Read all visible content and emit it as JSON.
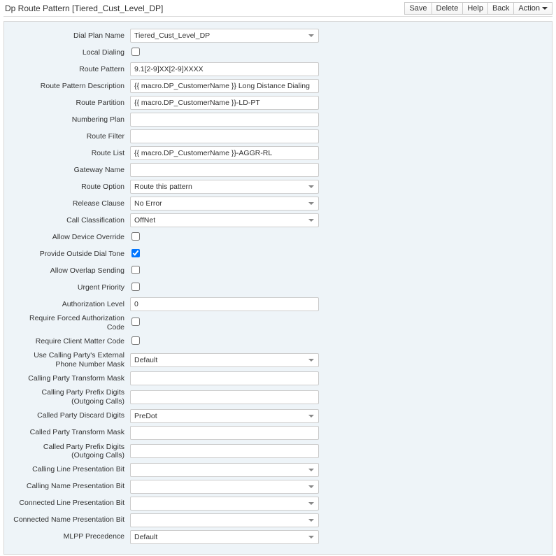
{
  "header": {
    "title": "Dp Route Pattern [Tiered_Cust_Level_DP]",
    "buttons": {
      "save": "Save",
      "delete": "Delete",
      "help": "Help",
      "back": "Back",
      "action": "Action"
    }
  },
  "fields": {
    "dial_plan_name": {
      "label": "Dial Plan Name",
      "value": "Tiered_Cust_Level_DP"
    },
    "local_dialing": {
      "label": "Local Dialing",
      "checked": false
    },
    "route_pattern": {
      "label": "Route Pattern",
      "value": "9.1[2-9]XX[2-9]XXXX"
    },
    "route_pattern_description": {
      "label": "Route Pattern Description",
      "value": "{{ macro.DP_CustomerName }} Long Distance Dialing"
    },
    "route_partition": {
      "label": "Route Partition",
      "value": "{{ macro.DP_CustomerName }}-LD-PT"
    },
    "numbering_plan": {
      "label": "Numbering Plan",
      "value": ""
    },
    "route_filter": {
      "label": "Route Filter",
      "value": ""
    },
    "route_list": {
      "label": "Route List",
      "value": "{{ macro.DP_CustomerName }}-AGGR-RL"
    },
    "gateway_name": {
      "label": "Gateway Name",
      "value": ""
    },
    "route_option": {
      "label": "Route Option",
      "value": "Route this pattern"
    },
    "release_clause": {
      "label": "Release Clause",
      "value": "No Error"
    },
    "call_classification": {
      "label": "Call Classification",
      "value": "OffNet"
    },
    "allow_device_override": {
      "label": "Allow Device Override",
      "checked": false
    },
    "provide_outside_dial_tone": {
      "label": "Provide Outside Dial Tone",
      "checked": true
    },
    "allow_overlap_sending": {
      "label": "Allow Overlap Sending",
      "checked": false
    },
    "urgent_priority": {
      "label": "Urgent Priority",
      "checked": false
    },
    "authorization_level": {
      "label": "Authorization Level",
      "value": "0"
    },
    "require_forced_authorization_code": {
      "label": "Require Forced Authorization Code",
      "checked": false
    },
    "require_client_matter_code": {
      "label": "Require Client Matter Code",
      "checked": false
    },
    "use_calling_party_external_mask": {
      "label": "Use Calling Party's External Phone Number Mask",
      "value": "Default"
    },
    "calling_party_transform_mask": {
      "label": "Calling Party Transform Mask",
      "value": ""
    },
    "calling_party_prefix_digits": {
      "label": "Calling Party Prefix Digits (Outgoing Calls)",
      "value": ""
    },
    "called_party_discard_digits": {
      "label": "Called Party Discard Digits",
      "value": "PreDot"
    },
    "called_party_transform_mask": {
      "label": "Called Party Transform Mask",
      "value": ""
    },
    "called_party_prefix_digits": {
      "label": "Called Party Prefix Digits (Outgoing Calls)",
      "value": ""
    },
    "calling_line_presentation_bit": {
      "label": "Calling Line Presentation Bit",
      "value": ""
    },
    "calling_name_presentation_bit": {
      "label": "Calling Name Presentation Bit",
      "value": ""
    },
    "connected_line_presentation_bit": {
      "label": "Connected Line Presentation Bit",
      "value": ""
    },
    "connected_name_presentation_bit": {
      "label": "Connected Name Presentation Bit",
      "value": ""
    },
    "mlpp_precedence": {
      "label": "MLPP Precedence",
      "value": "Default"
    }
  }
}
